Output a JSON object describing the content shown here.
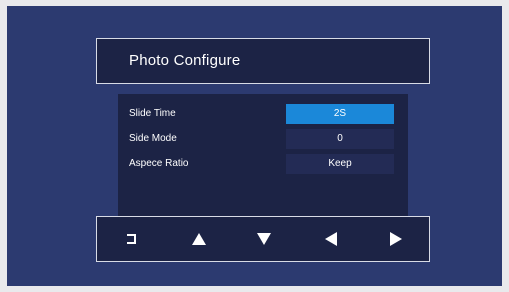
{
  "dialog": {
    "title": "Photo Configure"
  },
  "settings": [
    {
      "label": "Slide Time",
      "value": "2S",
      "selected": true
    },
    {
      "label": "Side Mode",
      "value": "0",
      "selected": false
    },
    {
      "label": "Aspece Ratio",
      "value": "Keep",
      "selected": false
    }
  ],
  "nav_buttons": [
    {
      "icon": "return-icon"
    },
    {
      "icon": "arrow-up-icon"
    },
    {
      "icon": "arrow-down-icon"
    },
    {
      "icon": "arrow-left-icon"
    },
    {
      "icon": "arrow-right-icon"
    }
  ],
  "colors": {
    "screen_background": "#2c3a70",
    "panel_background": "#1c2345",
    "value_background": "#232b55",
    "selected_value": "#1b88d9",
    "text": "#ffffff"
  }
}
